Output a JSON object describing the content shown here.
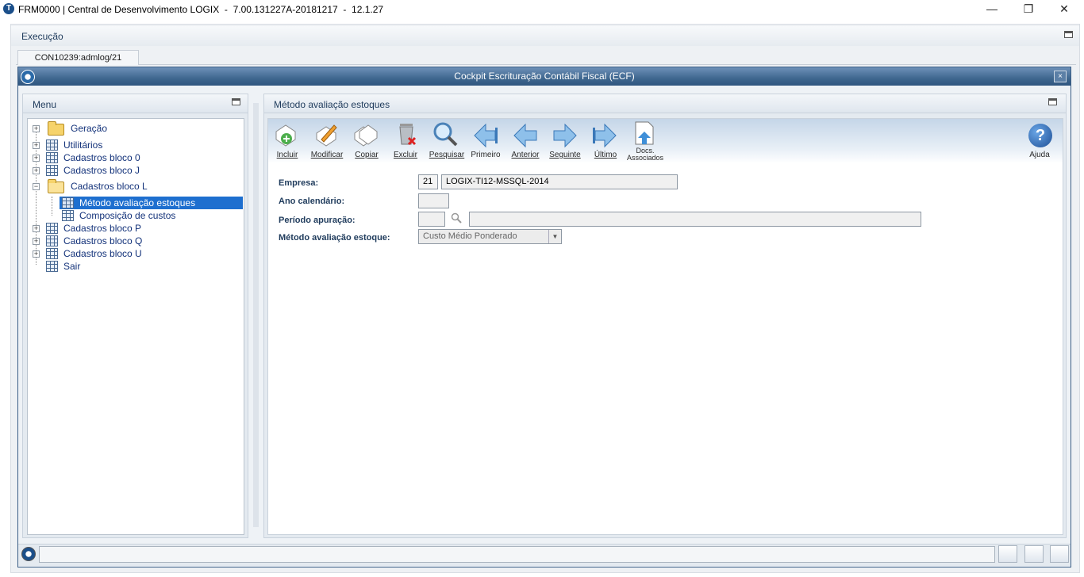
{
  "window": {
    "title": "FRM0000 | Central de Desenvolvimento LOGIX  -  7.00.131227A-20181217  -  12.1.27",
    "controls": [
      "minimize-icon",
      "restore-icon",
      "close-icon"
    ]
  },
  "execucao": {
    "label": "Execução"
  },
  "tabs": [
    {
      "label": "CON10239:admlog/21"
    }
  ],
  "inner_window": {
    "title": "Cockpit Escrituração Contábil Fiscal (ECF)",
    "close": "×",
    "logo": "T"
  },
  "menu": {
    "title": "Menu",
    "items": [
      {
        "label": "Geração"
      },
      {
        "label": "Utilitários"
      },
      {
        "label": "Cadastros bloco 0"
      },
      {
        "label": "Cadastros bloco J"
      },
      {
        "label": "Cadastros bloco L"
      },
      {
        "label": "Método avaliação estoques"
      },
      {
        "label": "Composição de custos"
      },
      {
        "label": "Cadastros bloco P"
      },
      {
        "label": "Cadastros bloco Q"
      },
      {
        "label": "Cadastros bloco U"
      },
      {
        "label": "Sair"
      }
    ]
  },
  "main": {
    "title": "Método avaliação estoques",
    "toolbar": {
      "incluir": "Incluir",
      "modificar": "Modificar",
      "copiar": "Copiar",
      "excluir": "Excluir",
      "pesquisar": "Pesquisar",
      "primeiro": "Primeiro",
      "anterior": "Anterior",
      "seguinte": "Seguinte",
      "ultimo": "Último",
      "docs_line1": "Docs.",
      "docs_line2": "Associados",
      "ajuda": "Ajuda",
      "ajuda_glyph": "?"
    },
    "form": {
      "empresa_label": "Empresa:",
      "empresa_code": "21",
      "empresa_name": "LOGIX-TI12-MSSQL-2014",
      "ano_label": "Ano calendário:",
      "ano_value": "",
      "periodo_label": "Período apuração:",
      "periodo_value": "",
      "periodo_desc": "",
      "metodo_label": "Método avaliação estoque:",
      "metodo_value": "Custo Médio Ponderado"
    }
  },
  "colors": {
    "title_bar": "#3f678f",
    "link_text": "#13327a",
    "selection": "#1e6fcf"
  }
}
